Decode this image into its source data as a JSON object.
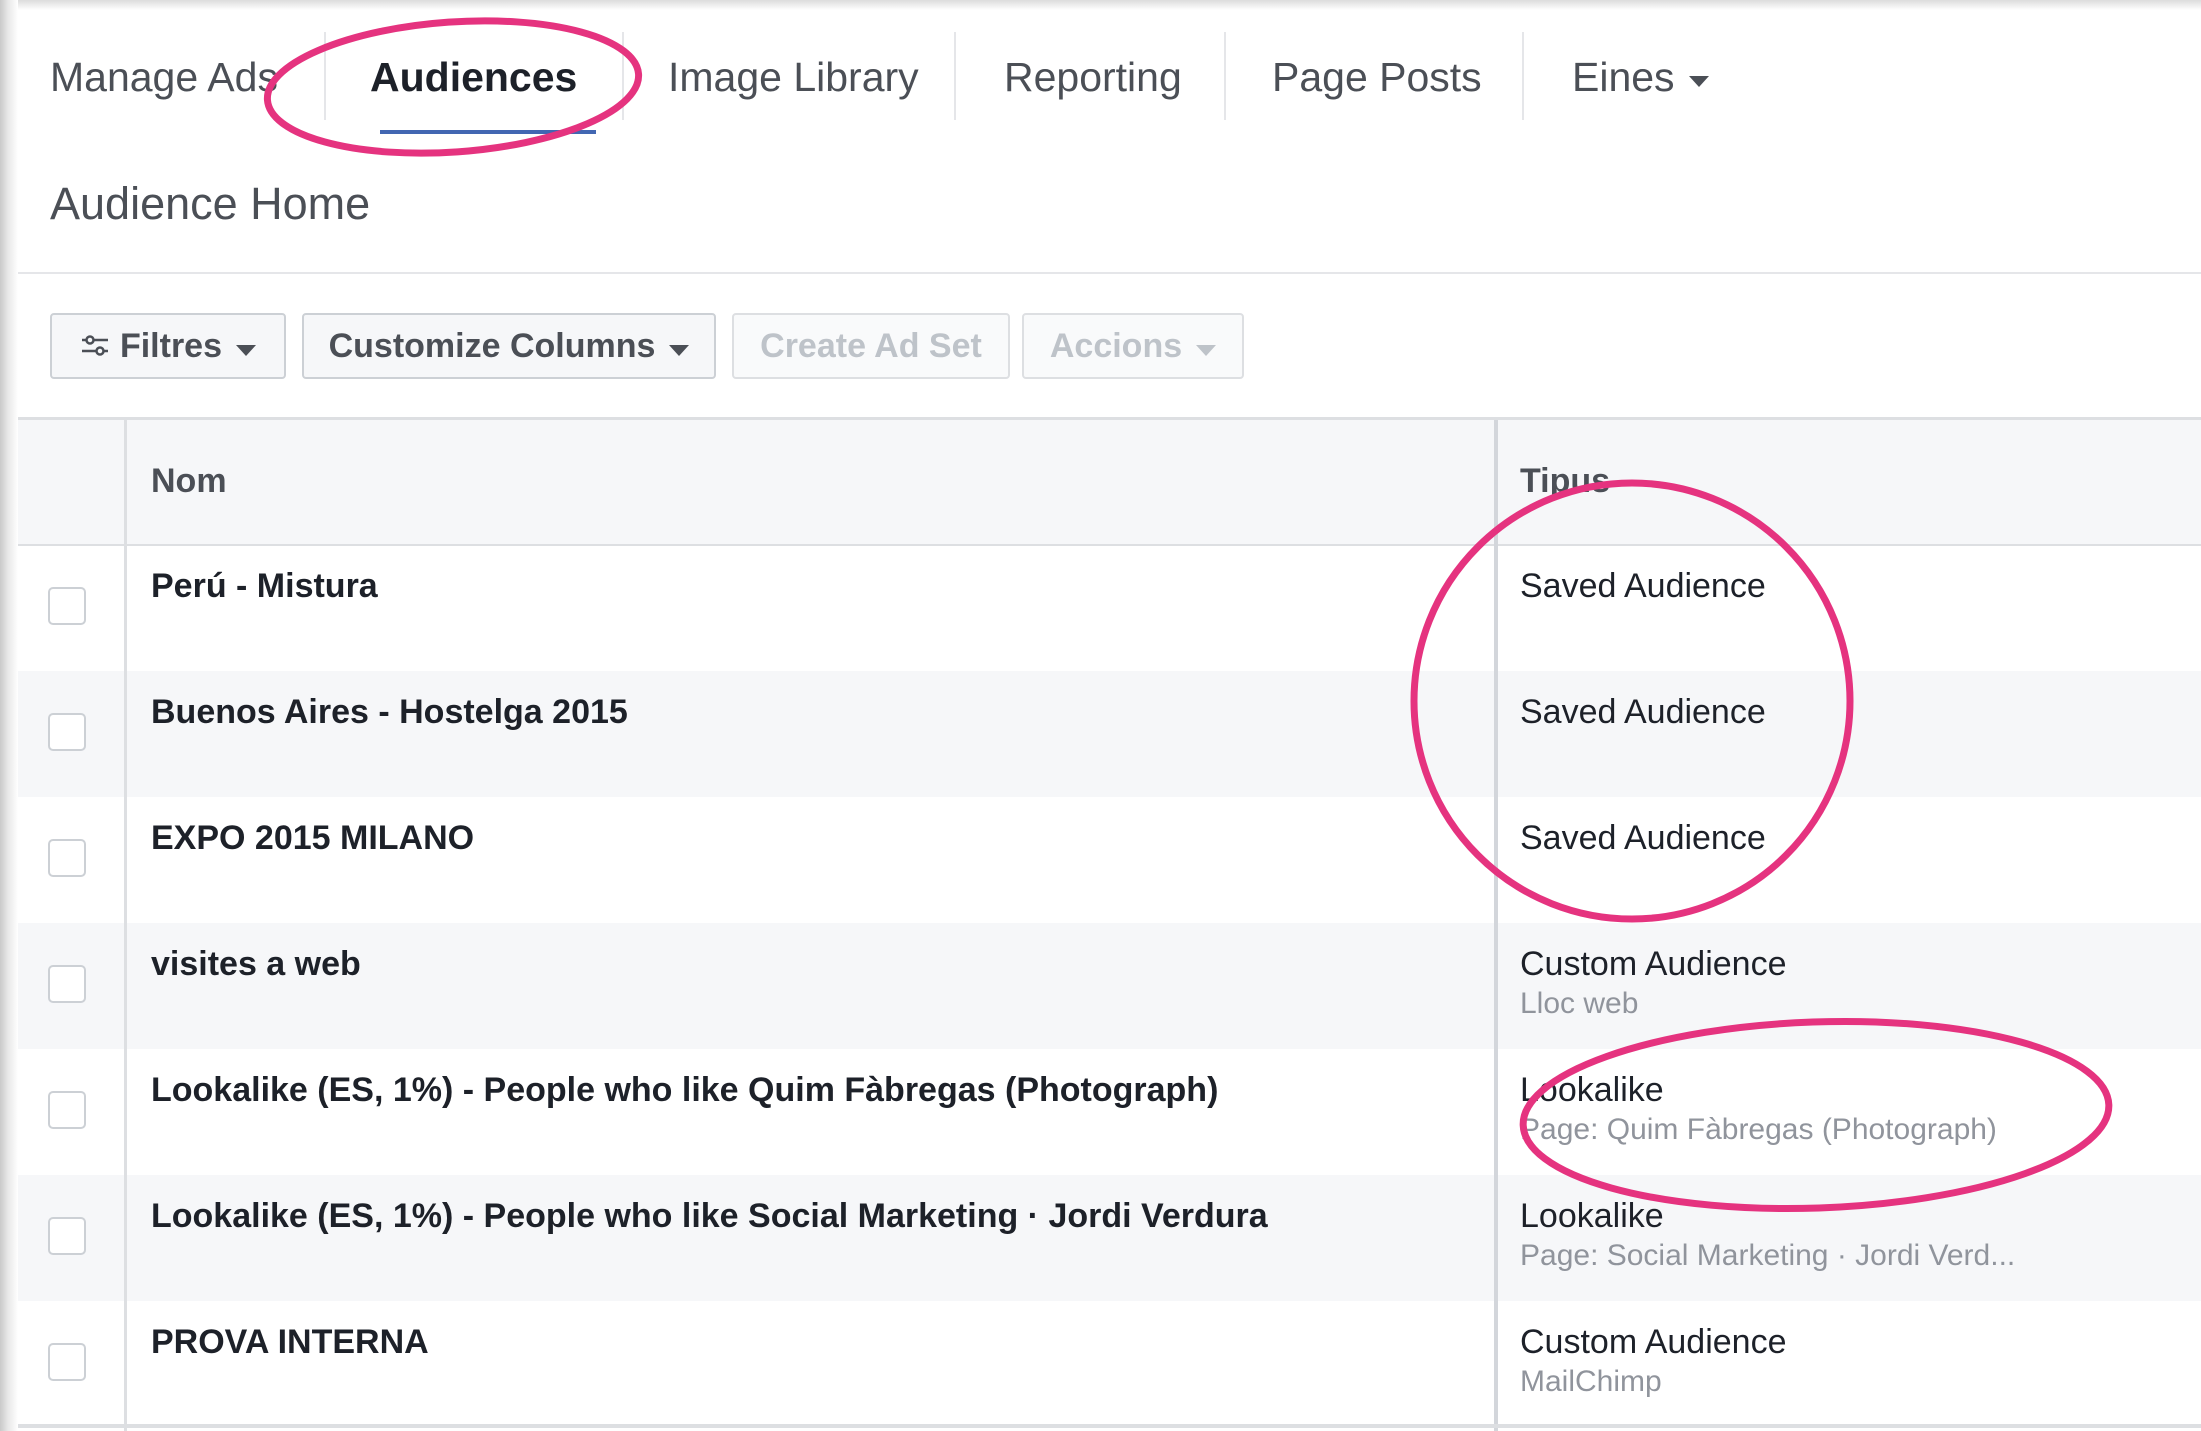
{
  "nav": {
    "tabs": [
      {
        "label": "Manage Ads",
        "active": false
      },
      {
        "label": "Audiences",
        "active": true
      },
      {
        "label": "Image Library",
        "active": false
      },
      {
        "label": "Reporting",
        "active": false
      },
      {
        "label": "Page Posts",
        "active": false
      },
      {
        "label": "Eines",
        "active": false,
        "dropdown": true
      }
    ]
  },
  "page": {
    "title": "Audience Home"
  },
  "toolbar": {
    "filters_label": "Filtres",
    "customize_label": "Customize Columns",
    "create_label": "Create Ad Set",
    "actions_label": "Accions"
  },
  "table": {
    "headers": {
      "name": "Nom",
      "type": "Tipus"
    },
    "rows": [
      {
        "name": "Perú - Mistura",
        "type": "Saved Audience",
        "sub": ""
      },
      {
        "name": "Buenos Aires - Hostelga 2015",
        "type": "Saved Audience",
        "sub": ""
      },
      {
        "name": "EXPO 2015 MILANO",
        "type": "Saved Audience",
        "sub": ""
      },
      {
        "name": "visites a web",
        "type": "Custom Audience",
        "sub": "Lloc web"
      },
      {
        "name": "Lookalike (ES, 1%) - People who like Quim Fàbregas (Photograph)",
        "type": "Lookalike",
        "sub": "Page: Quim Fàbregas (Photograph)"
      },
      {
        "name": "Lookalike (ES, 1%) - People who like Social Marketing · Jordi Verdura",
        "type": "Lookalike",
        "sub": "Page: Social Marketing · Jordi Verd..."
      },
      {
        "name": "PROVA INTERNA",
        "type": "Custom Audience",
        "sub": "MailChimp"
      }
    ]
  },
  "colors": {
    "annotation": "#e5337f",
    "active_underline": "#4267b2",
    "row_alt": "#f6f7f9"
  }
}
